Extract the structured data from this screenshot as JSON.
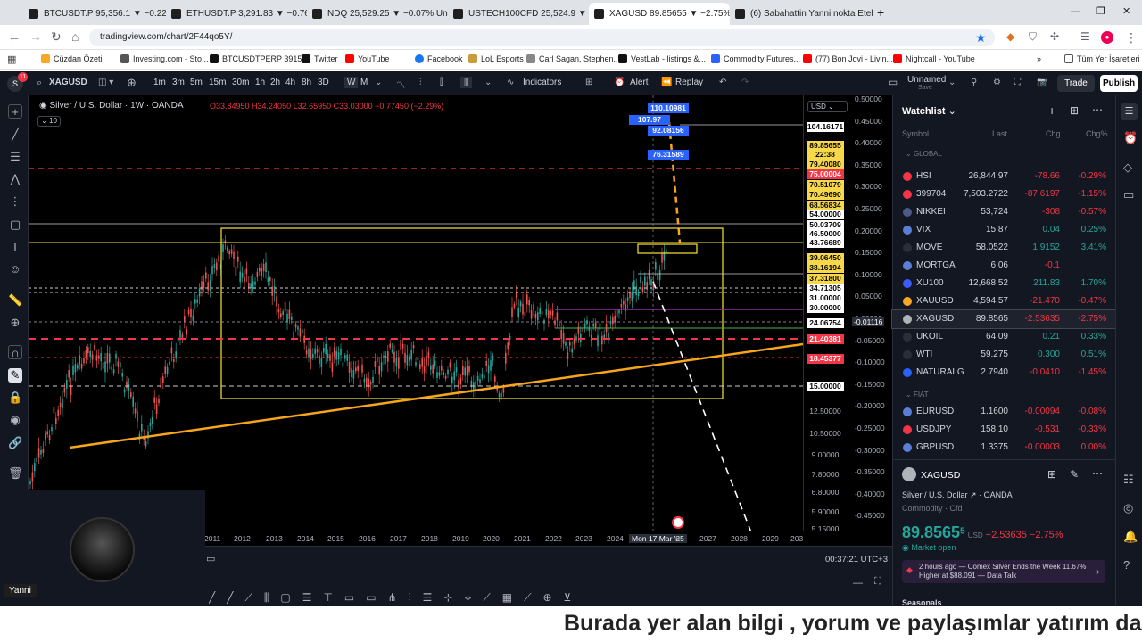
{
  "browser": {
    "tabs": [
      {
        "label": "BTCUSDT.P 95,356.1 ▼ −0.22%"
      },
      {
        "label": "ETHUSDT.P 3,291.83 ▼ −0.76%"
      },
      {
        "label": "NDQ 25,529.25 ▼ −0.07% Unn"
      },
      {
        "label": "USTECH100CFD 25,524.9 ▼ −0."
      },
      {
        "label": "XAGUSD 89.85655 ▼ −2.75% U"
      },
      {
        "label": "(6) Sabahattin Yanni nokta Eteh"
      }
    ],
    "new_tab": "+",
    "url": "tradingview.com/chart/2F44qo5Y/",
    "bookmarks": [
      "Cüzdan Özeti",
      "Investing.com - Sto...",
      "BTCUSDTPERP 3915...",
      "Twitter",
      "YouTube",
      "Facebook",
      "LoL Esports",
      "Carl Sagan, Stephen...",
      "VestLab - listings &...",
      "Commodity Futures...",
      "(77) Bon Jovi - Livin...",
      "Nightcall - YouTube"
    ],
    "bookmarks_more": "»",
    "all_bookmarks": "Tüm Yer İşaretleri"
  },
  "toolbar": {
    "symbol": "XAGUSD",
    "intervals": [
      "1m",
      "3m",
      "5m",
      "15m",
      "30m",
      "1h",
      "2h",
      "4h",
      "8h",
      "3D",
      "W",
      "M"
    ],
    "indicators": "Indicators",
    "alert": "Alert",
    "replay": "Replay",
    "layout_name": "Unnamed",
    "save": "Save",
    "trade": "Trade",
    "publish": "Publish"
  },
  "legend": {
    "title": "Silver / U.S. Dollar · 1W · OANDA",
    "ohlc": "O33.84950 H34.24050 L32.65950 C33.03000 −0.77450 (−2.29%)",
    "indicator_count": "10",
    "currency": "USD"
  },
  "price_labels": [
    {
      "v": "110.10981",
      "color": "#2962ff"
    },
    {
      "v": "107.97",
      "color": "#2962ff"
    },
    {
      "v": "104.16171",
      "color": "#ffffff"
    },
    {
      "v": "92.08156",
      "color": "#2962ff"
    },
    {
      "v": "89.85655",
      "color": "#f7d84a"
    },
    {
      "v": "22:38",
      "color": "#f7d84a"
    },
    {
      "v": "79.40080",
      "color": "#f7d84a"
    },
    {
      "v": "76.31589",
      "color": "#2962ff"
    },
    {
      "v": "75.00004",
      "color": "#f23645"
    },
    {
      "v": "70.51079",
      "color": "#f7d84a"
    },
    {
      "v": "70.49690",
      "color": "#f7d84a"
    },
    {
      "v": "68.56834",
      "color": "#f7d84a"
    },
    {
      "v": "54.00000",
      "color": "#ffffff"
    },
    {
      "v": "50.03709",
      "color": "#ffffff"
    },
    {
      "v": "46.50000",
      "color": "#ffffff"
    },
    {
      "v": "43.76689",
      "color": "#ffffff"
    },
    {
      "v": "39.06450",
      "color": "#f7d84a"
    },
    {
      "v": "38.16194",
      "color": "#f7d84a"
    },
    {
      "v": "37.31800",
      "color": "#f7d84a"
    },
    {
      "v": "34.71305",
      "color": "#ffffff"
    },
    {
      "v": "31.00000",
      "color": "#ffffff"
    },
    {
      "v": "30.00000",
      "color": "#ffffff"
    },
    {
      "v": "24.06754",
      "color": "#ffffff"
    },
    {
      "v": "21.40381",
      "color": "#f23645"
    },
    {
      "v": "18.45377",
      "color": "#f23645"
    },
    {
      "v": "15.00000",
      "color": "#ffffff"
    },
    {
      "v": "12.50000",
      "color": "none"
    },
    {
      "v": "10.50000",
      "color": "none"
    },
    {
      "v": "9.00000",
      "color": "none"
    },
    {
      "v": "7.80000",
      "color": "none"
    },
    {
      "v": "6.80000",
      "color": "none"
    },
    {
      "v": "5.90000",
      "color": "none"
    },
    {
      "v": "5.15000",
      "color": "none"
    }
  ],
  "right_scale": [
    "0.50000",
    "0.45000",
    "0.40000",
    "0.35000",
    "0.30000",
    "0.25000",
    "0.20000",
    "0.15000",
    "0.10000",
    "0.05000",
    "0.00000",
    "-0.01116",
    "-0.05000",
    "-0.10000",
    "-0.15000",
    "-0.20000",
    "-0.25000",
    "-0.30000",
    "-0.35000",
    "-0.40000",
    "-0.45000"
  ],
  "time_axis": [
    "2011",
    "2012",
    "2013",
    "2014",
    "2015",
    "2016",
    "2017",
    "2018",
    "2019",
    "2020",
    "2021",
    "2022",
    "2023",
    "2024",
    "Mon 17 Mar '25",
    "6",
    "2027",
    "2028",
    "2029",
    "203"
  ],
  "bottom": {
    "clock": "00:37:21 UTC+3"
  },
  "streamer": {
    "name": "Yanni"
  },
  "watchlist": {
    "title": "Watchlist",
    "columns": [
      "Symbol",
      "Last",
      "Chg",
      "Chg%"
    ],
    "sections": [
      "GLOBAL",
      "FIAT"
    ],
    "rows": [
      {
        "sym": "HSI",
        "last": "26,844.97",
        "chg": "-78.66",
        "pct": "-0.29%",
        "dir": "neg",
        "icon": "#f23645"
      },
      {
        "sym": "399704",
        "last": "7,503.2722",
        "chg": "-87.6197",
        "pct": "-1.15%",
        "dir": "neg",
        "icon": "#f23645"
      },
      {
        "sym": "NIKKEI",
        "last": "53,724",
        "chg": "-308",
        "pct": "-0.57%",
        "dir": "neg",
        "icon": "#4a5a8a"
      },
      {
        "sym": "VIX",
        "last": "15.87",
        "chg": "0.04",
        "pct": "0.25%",
        "dir": "pos",
        "icon": "#5b7fd6"
      },
      {
        "sym": "MOVE",
        "last": "58.0522",
        "chg": "1.9152",
        "pct": "3.41%",
        "dir": "pos",
        "icon": "#2a2e39"
      },
      {
        "sym": "MORTGA",
        "last": "6.06",
        "chg": "-0.1",
        "pct": "",
        "dir": "neg",
        "icon": "#5b7fd6"
      },
      {
        "sym": "XU100",
        "last": "12,668.52",
        "chg": "211.83",
        "pct": "1.70%",
        "dir": "pos",
        "icon": "#3d5afe"
      },
      {
        "sym": "XAUUSD",
        "last": "4,594.57",
        "chg": "-21.470",
        "pct": "-0.47%",
        "dir": "neg",
        "icon": "#f9a825"
      },
      {
        "sym": "XAGUSD",
        "last": "89.8565",
        "chg": "-2.53635",
        "pct": "-2.75%",
        "dir": "neg",
        "icon": "#b0b3b8"
      },
      {
        "sym": "UKOIL",
        "last": "64.09",
        "chg": "0.21",
        "pct": "0.33%",
        "dir": "pos",
        "icon": "#2a2e39"
      },
      {
        "sym": "WTI",
        "last": "59.275",
        "chg": "0.300",
        "pct": "0.51%",
        "dir": "pos",
        "icon": "#2a2e39"
      },
      {
        "sym": "NATURALG",
        "last": "2.7940",
        "chg": "-0.0410",
        "pct": "-1.45%",
        "dir": "neg",
        "icon": "#2962ff"
      },
      {
        "sym": "EURUSD",
        "last": "1.1600",
        "chg": "-0.00094",
        "pct": "-0.08%",
        "dir": "neg",
        "icon": "#5b7fd6"
      },
      {
        "sym": "USDJPY",
        "last": "158.10",
        "chg": "-0.531",
        "pct": "-0.33%",
        "dir": "neg",
        "icon": "#f23645"
      },
      {
        "sym": "GBPUSD",
        "last": "1.3375",
        "chg": "-0.00003",
        "pct": "0.00%",
        "dir": "neg",
        "icon": "#5b7fd6"
      }
    ]
  },
  "details": {
    "symbol": "XAGUSD",
    "name": "Silver / U.S. Dollar",
    "exchange": "OANDA",
    "category": "Commodity · Cfd",
    "price": "89.8565",
    "price_sup": "5",
    "currency": "USD",
    "change": "−2.53635",
    "change_pct": "−2.75%",
    "status": "Market open",
    "news_time": "2 hours ago",
    "news_text": "Comex Silver Ends the Week 11.67% Higher at $88.091 — Data Talk",
    "seasonals": "Seasonals"
  },
  "subtitle": "Burada yer alan bilgi , yorum ve paylaşımlar yatırım da",
  "colors": {
    "bg": "#000000",
    "panel": "#131722",
    "up": "#26a69a",
    "down": "#f23645",
    "accent": "#2962ff",
    "trend": "#f7a51c",
    "box": "#f7e43a"
  }
}
